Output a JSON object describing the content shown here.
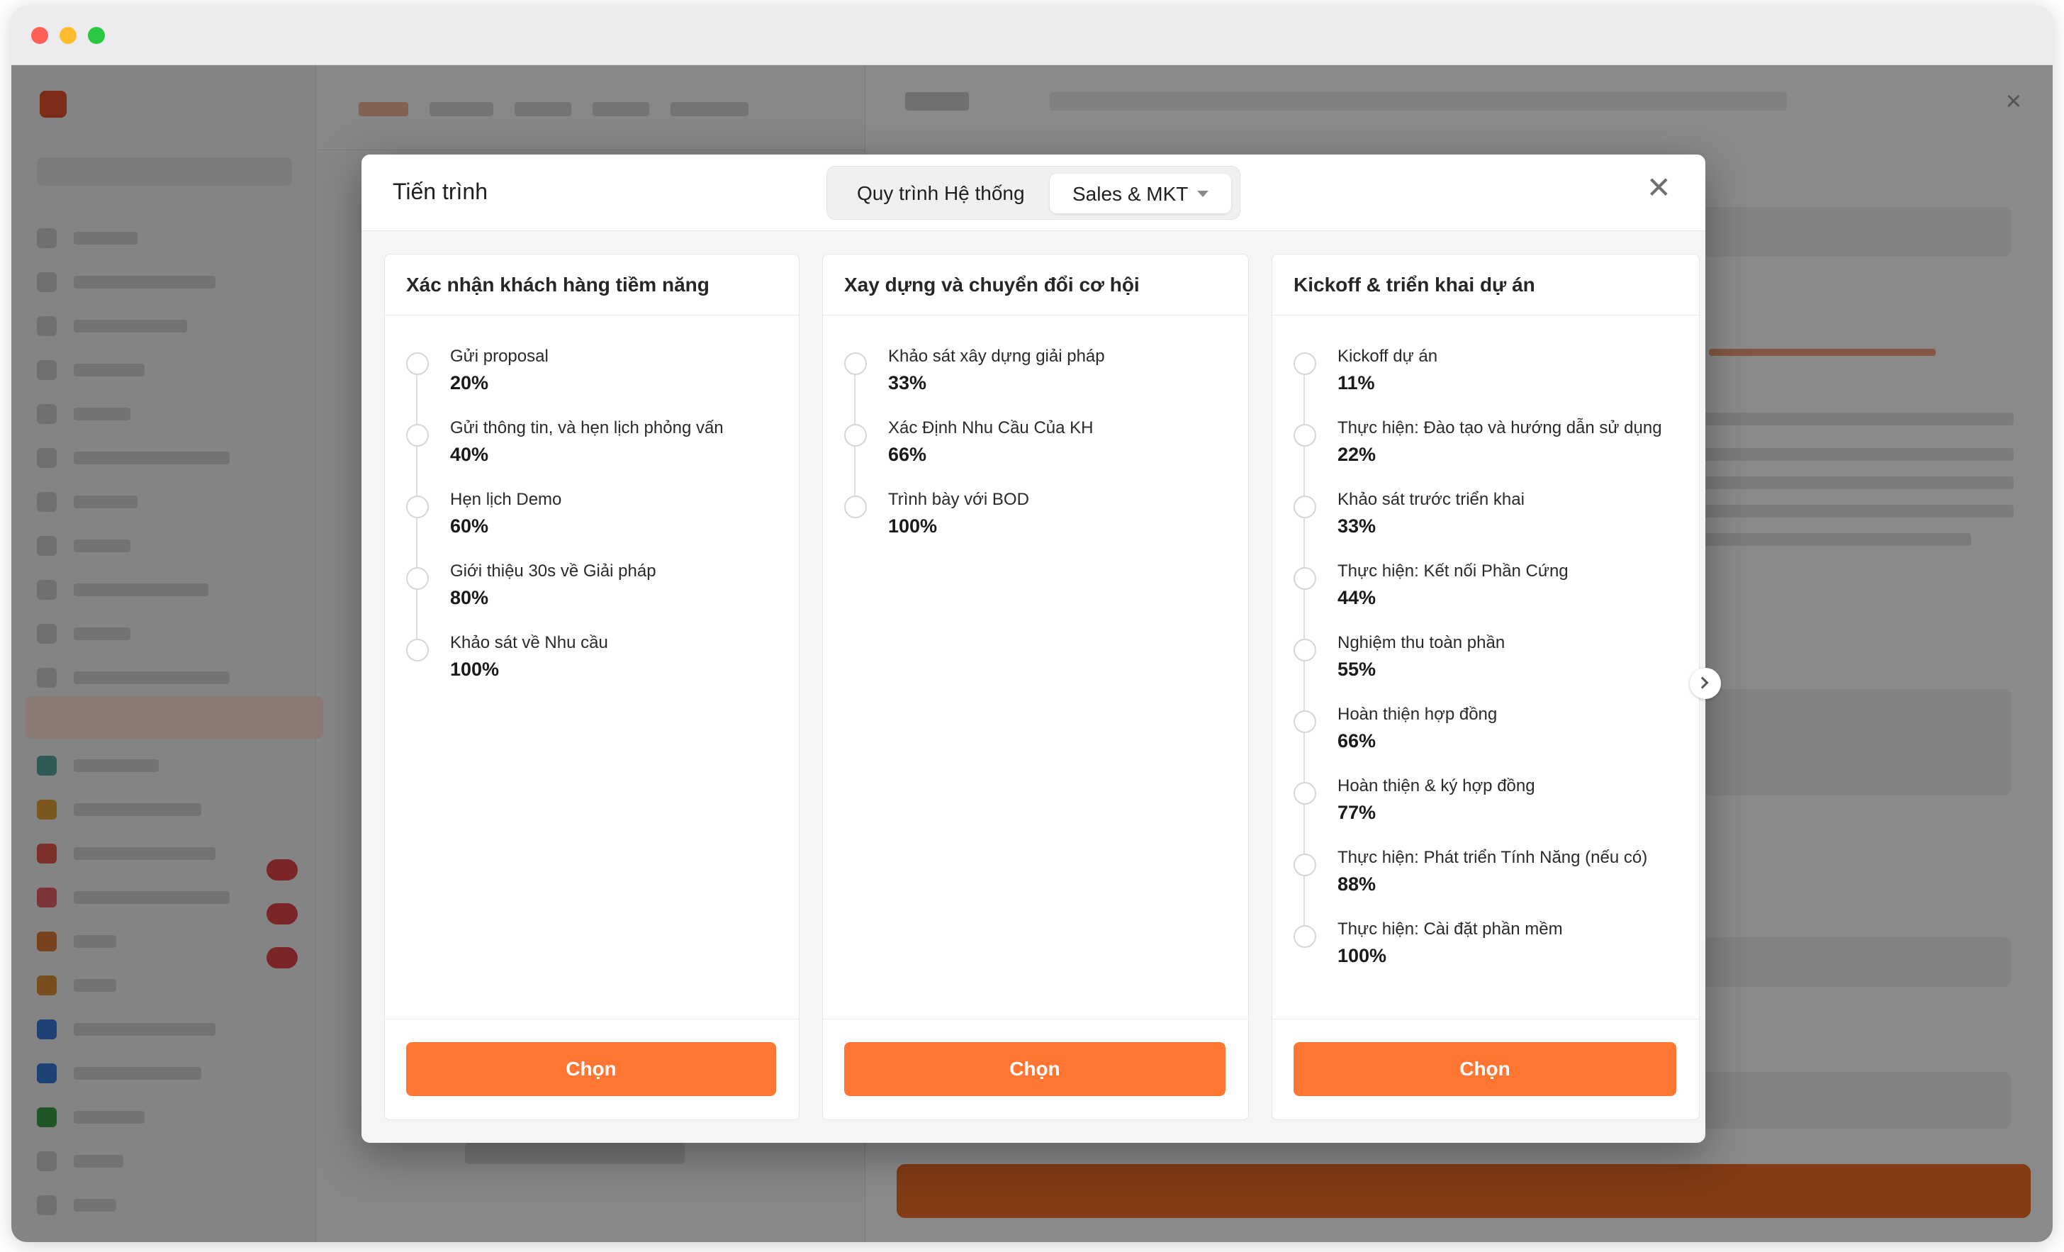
{
  "modal": {
    "title": "Tiến trình",
    "segment_label": "Quy trình Hệ thống",
    "segment_value": "Sales & MKT"
  },
  "columns": [
    {
      "title": "Xác nhận khách hàng tiềm năng",
      "button": "Chọn",
      "steps": [
        {
          "label": "Gửi proposal",
          "pct": "20%"
        },
        {
          "label": "Gửi thông tin, và hẹn lịch phỏng vấn",
          "pct": "40%"
        },
        {
          "label": "Hẹn lịch Demo",
          "pct": "60%"
        },
        {
          "label": "Giới thiệu 30s về Giải pháp",
          "pct": "80%"
        },
        {
          "label": "Khảo sát về Nhu cầu",
          "pct": "100%"
        }
      ]
    },
    {
      "title": "Xay dựng và chuyển đổi cơ hội",
      "button": "Chọn",
      "steps": [
        {
          "label": "Khảo sát xây dựng giải pháp",
          "pct": "33%"
        },
        {
          "label": "Xác Định Nhu Cầu Của KH",
          "pct": "66%"
        },
        {
          "label": "Trình bày với BOD",
          "pct": "100%"
        }
      ]
    },
    {
      "title": "Kickoff & triển khai dự án",
      "button": "Chọn",
      "steps": [
        {
          "label": "Kickoff dự án",
          "pct": "11%"
        },
        {
          "label": "Thực hiện: Đào tạo và hướng dẫn sử dụng",
          "pct": "22%"
        },
        {
          "label": "Khảo sát trước triển khai",
          "pct": "33%"
        },
        {
          "label": "Thực hiện: Kết nối Phần Cứng",
          "pct": "44%"
        },
        {
          "label": "Nghiệm thu toàn phần",
          "pct": "55%"
        },
        {
          "label": "Hoàn thiện hợp đồng",
          "pct": "66%"
        },
        {
          "label": "Hoàn thiện & ký hợp đồng",
          "pct": "77%"
        },
        {
          "label": "Thực hiện: Phát triển Tính Năng (nếu có)",
          "pct": "88%"
        },
        {
          "label": "Thực hiện: Cài đặt phần mềm",
          "pct": "100%"
        }
      ]
    }
  ],
  "icons": {
    "close": "close-icon",
    "caret": "chevron-down-icon",
    "next": "chevron-right-icon"
  },
  "colors": {
    "accent": "#ff7633"
  }
}
